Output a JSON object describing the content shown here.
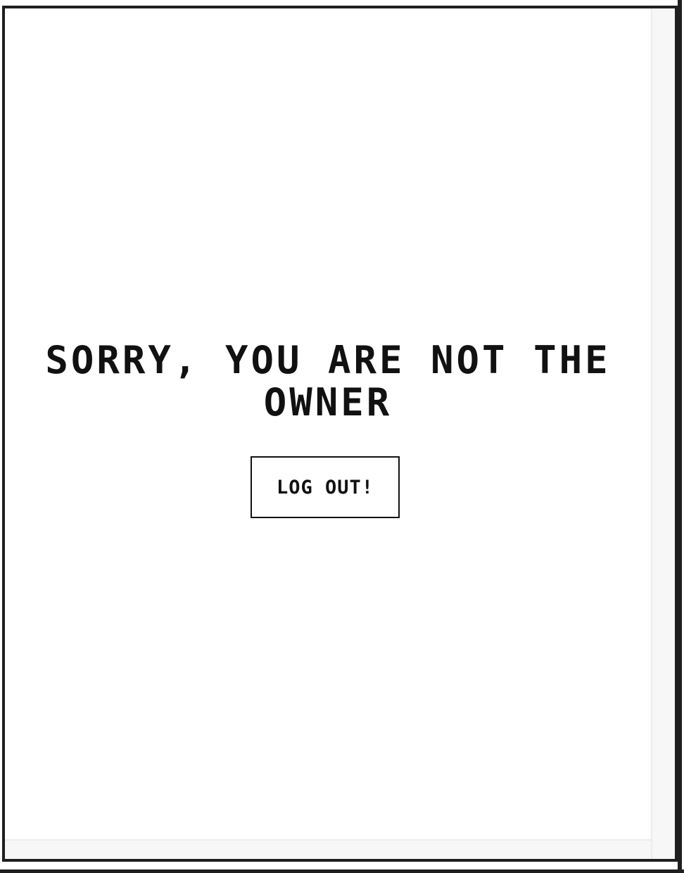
{
  "message": {
    "title": "SORRY, YOU ARE NOT THE OWNER"
  },
  "actions": {
    "logout_label": "LOG OUT!"
  }
}
